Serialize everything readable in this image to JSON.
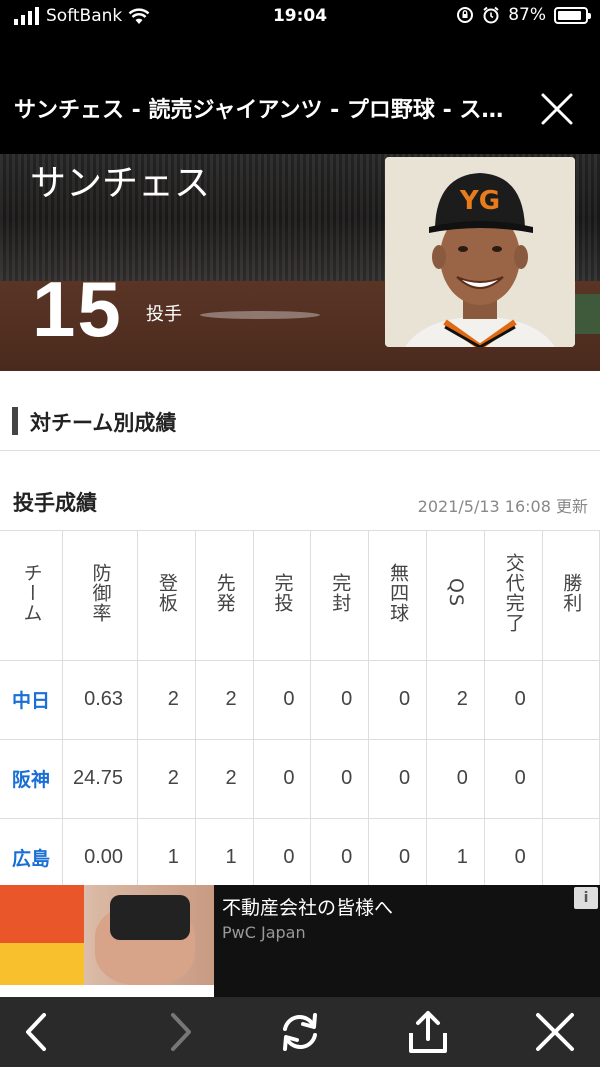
{
  "status_bar": {
    "carrier": "SoftBank",
    "time": "19:04",
    "battery_percent": "87%",
    "battery_level": 0.87
  },
  "browser": {
    "page_title": "サンチェス - 読売ジャイアンツ - プロ野球 - スポーツナビ"
  },
  "player": {
    "name": "サンチェス",
    "number": "15",
    "position": "投手"
  },
  "section": {
    "title": "対チーム別成績"
  },
  "stats": {
    "title": "投手成績",
    "updated": "2021/5/13 16:08 更新",
    "headers": [
      "チーム",
      "防御率",
      "登板",
      "先発",
      "完投",
      "完封",
      "無四球",
      "QS",
      "交代完了",
      "勝利"
    ],
    "rows": [
      {
        "team": "中日",
        "values": [
          "0.63",
          "2",
          "2",
          "0",
          "0",
          "0",
          "2",
          "0"
        ]
      },
      {
        "team": "阪神",
        "values": [
          "24.75",
          "2",
          "2",
          "0",
          "0",
          "0",
          "0",
          "0"
        ]
      },
      {
        "team": "広島",
        "values": [
          "0.00",
          "1",
          "1",
          "0",
          "0",
          "0",
          "1",
          "0"
        ]
      }
    ]
  },
  "ad": {
    "headline": "不動産会社の皆様へ",
    "sponsor": "PwC Japan",
    "info_icon": "i"
  },
  "toolbar": {
    "icons": [
      "chevron-left-icon",
      "chevron-right-icon",
      "refresh-icon",
      "share-icon",
      "close-icon"
    ]
  }
}
